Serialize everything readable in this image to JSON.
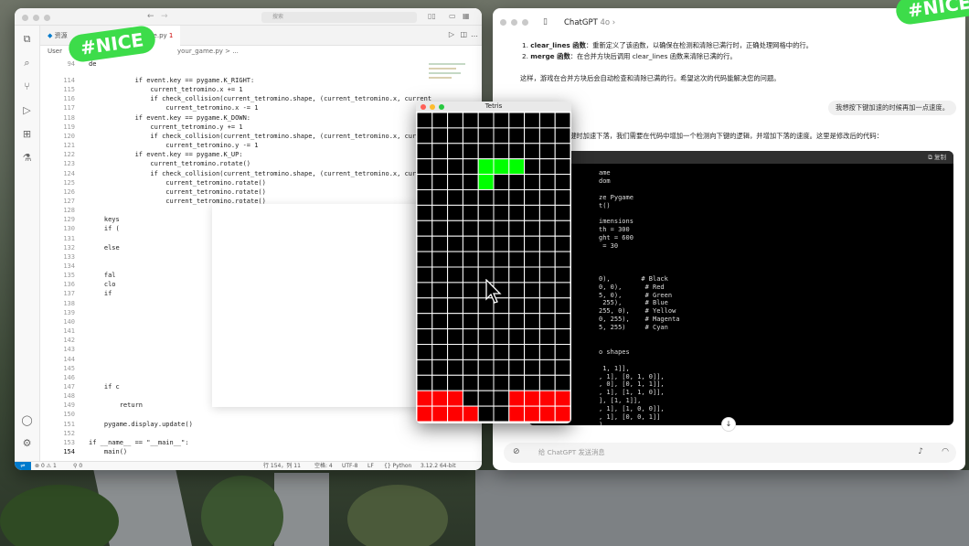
{
  "vscode": {
    "search_placeholder": "搜索",
    "tab_explorer": "资源",
    "tab_file": "game.py",
    "tab_file_state": "1",
    "breadcrumb": "your_game.py > ...",
    "side_label": "User",
    "code_lines": [
      {
        "n": "94",
        "t": "de"
      },
      {
        "n": "114",
        "t": "            if event.key == pygame.K_RIGHT:"
      },
      {
        "n": "115",
        "t": "                current_tetromino.x += 1"
      },
      {
        "n": "116",
        "t": "                if check_collision(current_tetromino.shape, (current_tetromino.x, current_"
      },
      {
        "n": "117",
        "t": "                    current_tetromino.x -= 1"
      },
      {
        "n": "118",
        "t": "            if event.key == pygame.K_DOWN:"
      },
      {
        "n": "119",
        "t": "                current_tetromino.y += 1"
      },
      {
        "n": "120",
        "t": "                if check_collision(current_tetromino.shape, (current_tetromino.x, curren"
      },
      {
        "n": "121",
        "t": "                    current_tetromino.y -= 1"
      },
      {
        "n": "122",
        "t": "            if event.key == pygame.K_UP:"
      },
      {
        "n": "123",
        "t": "                current_tetromino.rotate()"
      },
      {
        "n": "124",
        "t": "                if check_collision(current_tetromino.shape, (current_tetromino.x, curren"
      },
      {
        "n": "125",
        "t": "                    current_tetromino.rotate()"
      },
      {
        "n": "126",
        "t": "                    current_tetromino.rotate()"
      },
      {
        "n": "127",
        "t": "                    current_tetromino.rotate()"
      },
      {
        "n": "128",
        "t": ""
      },
      {
        "n": "129",
        "t": "    keys"
      },
      {
        "n": "130",
        "t": "    if ("
      },
      {
        "n": "131",
        "t": ""
      },
      {
        "n": "132",
        "t": "    else"
      },
      {
        "n": "133",
        "t": ""
      },
      {
        "n": "134",
        "t": ""
      },
      {
        "n": "135",
        "t": "    fal"
      },
      {
        "n": "136",
        "t": "    clo"
      },
      {
        "n": "137",
        "t": "    if"
      },
      {
        "n": "138",
        "t": ""
      },
      {
        "n": "139",
        "t": ""
      },
      {
        "n": "140",
        "t": ""
      },
      {
        "n": "141",
        "t": ""
      },
      {
        "n": "142",
        "t": ""
      },
      {
        "n": "143",
        "t": ""
      },
      {
        "n": "144",
        "t": ""
      },
      {
        "n": "145",
        "t": ""
      },
      {
        "n": "146",
        "t": ""
      },
      {
        "n": "147",
        "t": "    if c"
      },
      {
        "n": "148",
        "t": ""
      },
      {
        "n": "149",
        "t": "        return"
      },
      {
        "n": "150",
        "t": ""
      },
      {
        "n": "151",
        "t": "    pygame.display.update()"
      },
      {
        "n": "152",
        "t": ""
      },
      {
        "n": "153",
        "t": "if __name__ == \"__main__\":"
      },
      {
        "n": "154",
        "t": "    main()"
      }
    ],
    "status": {
      "errors": "0",
      "warnings": "1",
      "ports": "0",
      "position": "行 154，列 11",
      "spaces": "空格: 4",
      "encoding": "UTF-8",
      "eol": "LF",
      "language": "Python",
      "interpreter": "3.12.2 64-bit"
    }
  },
  "tetris": {
    "title": "Tetris",
    "cols": 10,
    "rows": 20,
    "colors": {
      "empty": "#000000",
      "grid": "#ffffff",
      "green": "#00ff00",
      "red": "#ff0000"
    },
    "green_cells": [
      [
        4,
        3
      ],
      [
        5,
        3
      ],
      [
        6,
        3
      ],
      [
        4,
        4
      ]
    ],
    "red_cells": [
      [
        0,
        18
      ],
      [
        1,
        18
      ],
      [
        2,
        18
      ],
      [
        6,
        18
      ],
      [
        7,
        18
      ],
      [
        8,
        18
      ],
      [
        9,
        18
      ],
      [
        0,
        19
      ],
      [
        1,
        19
      ],
      [
        2,
        19
      ],
      [
        3,
        19
      ],
      [
        6,
        19
      ],
      [
        7,
        19
      ],
      [
        8,
        19
      ],
      [
        9,
        19
      ]
    ]
  },
  "chat": {
    "title": "ChatGPT",
    "model": "4o",
    "item1_name": "clear_lines 函数",
    "item1_text": "：重新定义了该函数，以确保在检测和清除已满行时，正确处理网格中的行。",
    "item2_name": "merge 函数",
    "item2_text": "：在合并方块后调用 clear_lines 函数来清除已满的行。",
    "summary": "这样，游戏在合并方块后会自动检查和清除已满的行。希望这次的代码能解决您的问题。",
    "user_msg": "我想按下键加速的时候再加一点速度。",
    "reply_text": "键时加速下落，我们需要在代码中增加一个检测向下键的逻辑，并增加下落的速度。这里是修改后的代码：",
    "copy_label": "复制",
    "code_lines": [
      "ame",
      "dom",
      "",
      "ze Pygame",
      "t()",
      "",
      "imensions",
      "th = 300",
      "ght = 600",
      " = 30",
      "",
      "",
      "",
      "0),        # Black",
      "0, 0),      # Red",
      "5, 0),      # Green",
      " 255),      # Blue",
      "255, 0),    # Yellow",
      "0, 255),    # Magenta",
      "5, 255)     # Cyan",
      "",
      "",
      "o shapes",
      "",
      " 1, 1]],",
      ", 1], [0, 1, 0]],",
      ", 0], [0, 1, 1]],",
      ", 1], [1, 1, 0]],",
      "], [1, 1]],",
      ", 1], [1, 0, 0]],",
      ", 1], [0, 0, 1]]",
      "]"
    ],
    "input_placeholder": "给 ChatGPT 发送消息"
  },
  "stickers": {
    "left": "#NICE",
    "right": "#NICE"
  }
}
